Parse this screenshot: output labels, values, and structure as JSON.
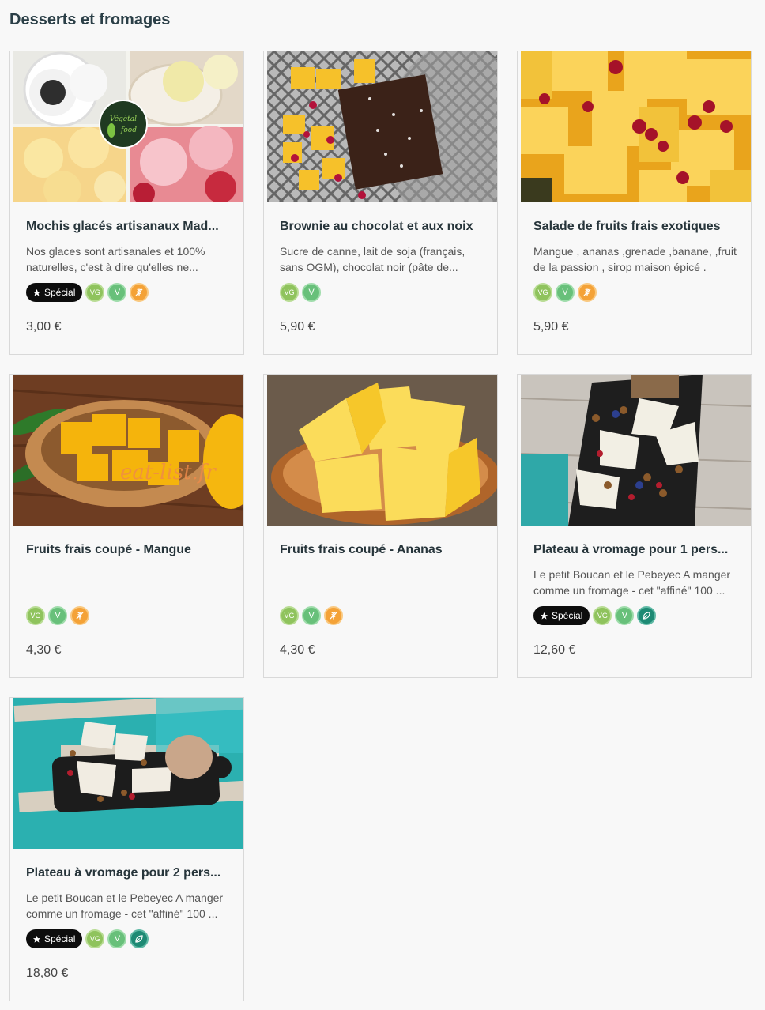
{
  "section": {
    "title": "Desserts et fromages"
  },
  "labels": {
    "special": "Spécial",
    "vg": "VG",
    "v": "V"
  },
  "products": [
    {
      "name": "Mochis glacés artisanaux Mad...",
      "description": "Nos glaces sont artisanales et 100% naturelles, c'est à dire qu'elles ne...",
      "price": "3,00 €",
      "special": true,
      "diet": [
        "vg",
        "v",
        "gluten-free"
      ],
      "image": "mochi",
      "image_text": "Végétal food"
    },
    {
      "name": "Brownie au chocolat et aux noix",
      "description": "Sucre de canne, lait de soja (français, sans OGM), chocolat noir (pâte de...",
      "price": "5,90 €",
      "special": false,
      "diet": [
        "vg",
        "v"
      ],
      "image": "brownie"
    },
    {
      "name": "Salade de fruits frais exotiques",
      "description": "Mangue , ananas ,grenade ,banane, ,fruit de la passion , sirop maison épicé .",
      "price": "5,90 €",
      "special": false,
      "diet": [
        "vg",
        "v",
        "gluten-free"
      ],
      "image": "salad"
    },
    {
      "name": "Fruits frais coupé - Mangue",
      "description": "",
      "price": "4,30 €",
      "special": false,
      "diet": [
        "vg",
        "v",
        "gluten-free"
      ],
      "image": "mango",
      "image_text": "eat-list.fr"
    },
    {
      "name": "Fruits frais coupé - Ananas",
      "description": "",
      "price": "4,30 €",
      "special": false,
      "diet": [
        "vg",
        "v",
        "gluten-free"
      ],
      "image": "pineapple"
    },
    {
      "name": "Plateau à vromage pour 1 pers...",
      "description": "Le petit Boucan et le Pebeyec A manger comme un fromage - cet \"affiné\" 100 ...",
      "price": "12,60 €",
      "special": true,
      "diet": [
        "vg",
        "v",
        "leaf"
      ],
      "image": "cheese1"
    },
    {
      "name": "Plateau à vromage pour 2 pers...",
      "description": "Le petit Boucan et le Pebeyec A manger comme un fromage - cet \"affiné\" 100 ...",
      "price": "18,80 €",
      "special": true,
      "diet": [
        "vg",
        "v",
        "leaf"
      ],
      "image": "cheese2"
    }
  ]
}
